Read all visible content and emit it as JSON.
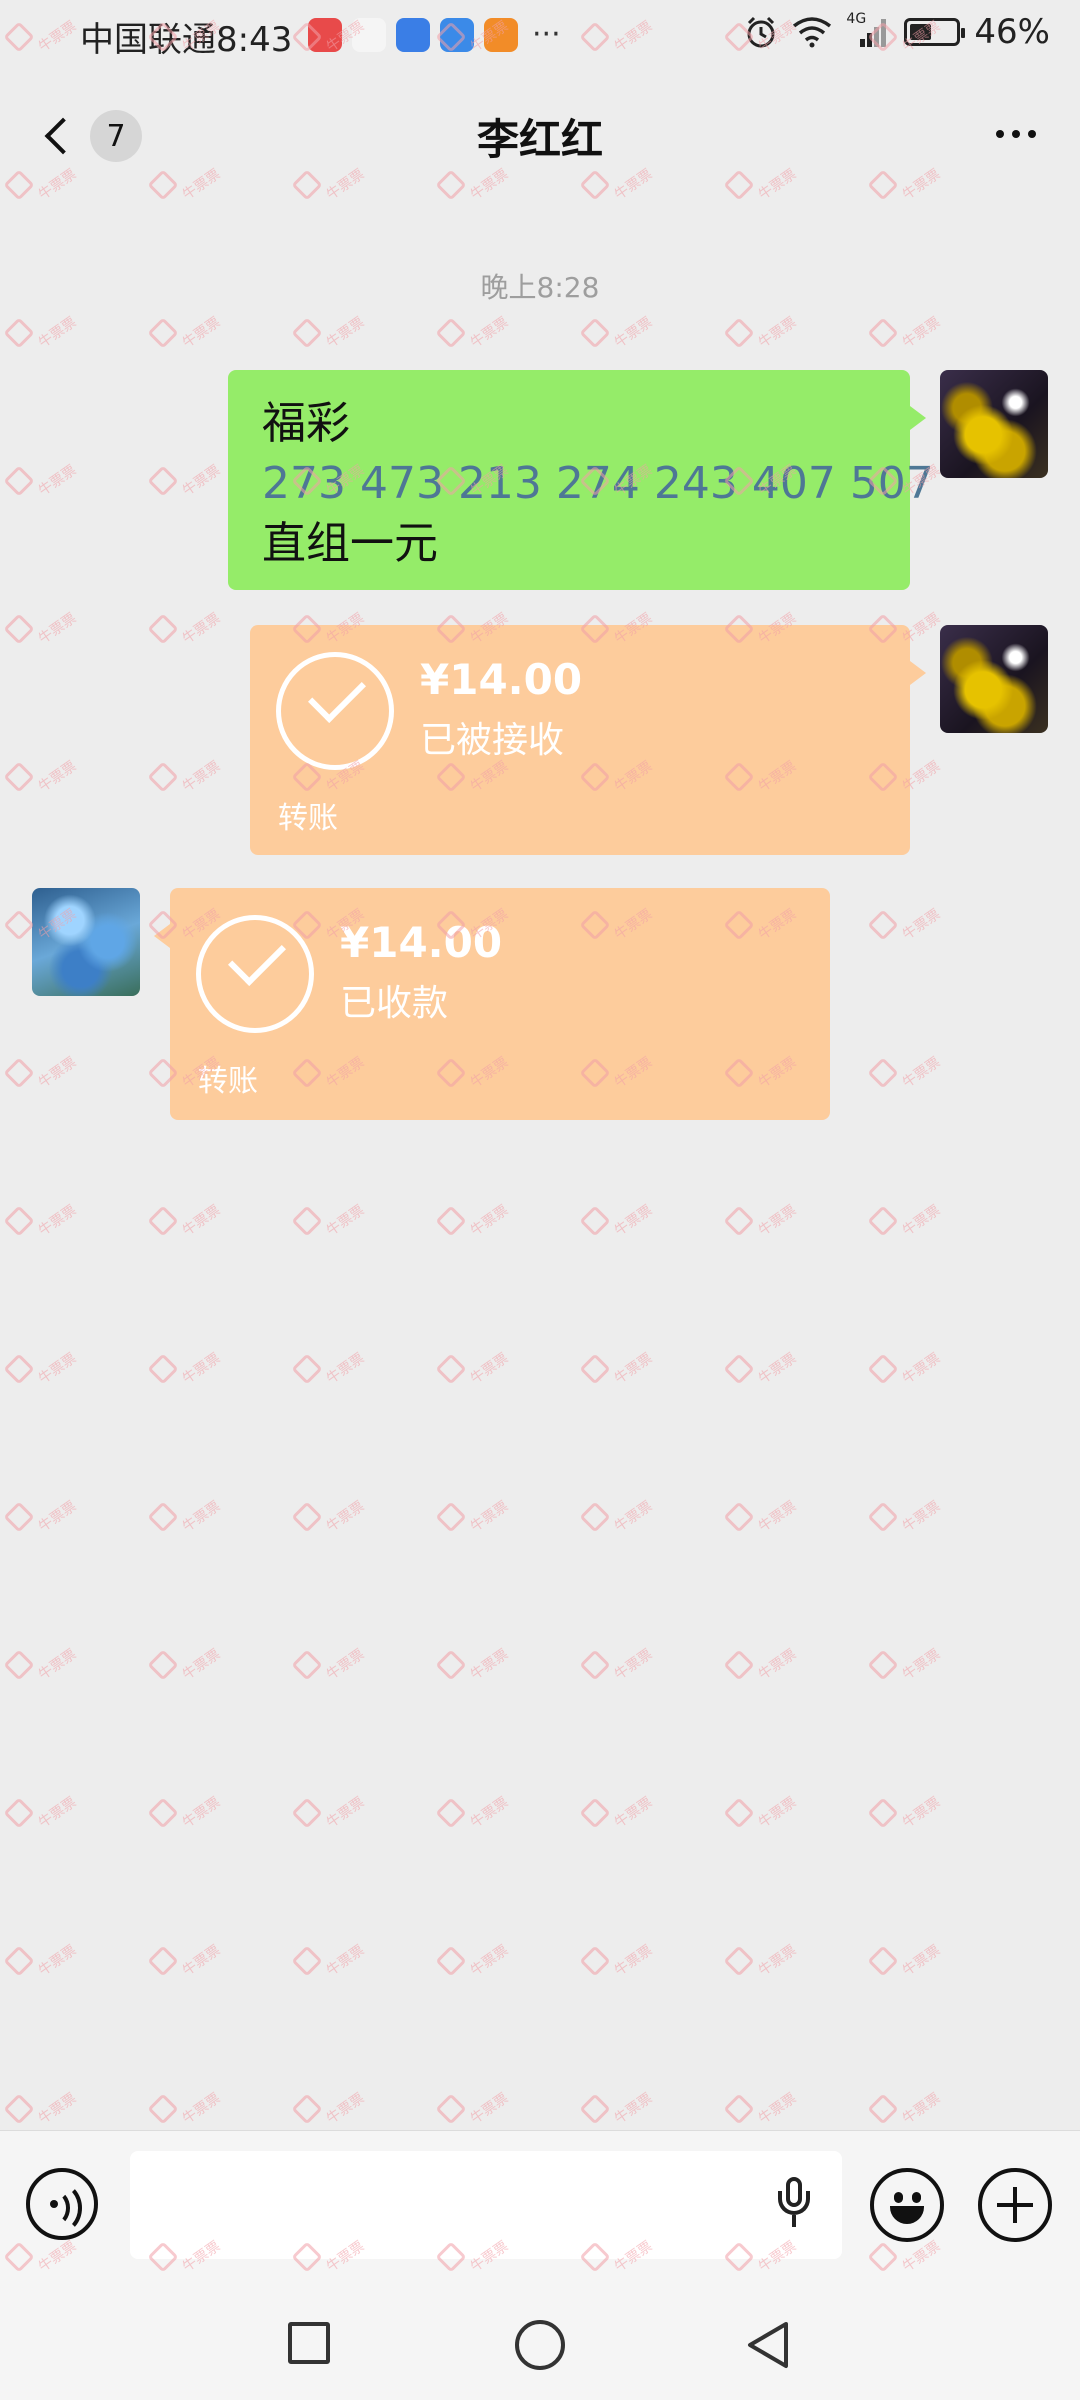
{
  "status_bar": {
    "carrier": "中国联通",
    "time": "8:43",
    "network": "4G",
    "battery_percent": "46%",
    "battery_level": 0.46,
    "app_icons": [
      {
        "name": "huawei-app-icon",
        "color": "#e84a4a"
      },
      {
        "name": "game-app-icon",
        "color": "#f5f5f5"
      },
      {
        "name": "browser-app-icon",
        "color": "#3a7ee6"
      },
      {
        "name": "weather-app-icon",
        "color": "#3b8ae8"
      },
      {
        "name": "video-app-icon",
        "color": "#f28c28"
      }
    ],
    "more": "···"
  },
  "header": {
    "unread_count": "7",
    "title": "李红红",
    "more_icon": "more-dots-icon",
    "back_icon": "chevron-left-icon"
  },
  "conversation": {
    "timestamp": "晚上8:28",
    "messages": {
      "text_message": {
        "line1": "福彩",
        "line2": "273 473 213 274 243 407 507",
        "line3": "直组一元"
      },
      "transfer_sent": {
        "amount": "¥14.00",
        "status": "已被接收",
        "footer": "转账"
      },
      "transfer_received": {
        "amount": "¥14.00",
        "status": "已收款",
        "footer": "转账"
      }
    }
  },
  "input_bar": {
    "placeholder": "",
    "voice_icon": "voice-mode-icon",
    "mic_icon": "microphone-icon",
    "emoji_icon": "emoji-icon",
    "plus_icon": "plus-icon"
  },
  "colors": {
    "background": "#ededed",
    "bubble_green": "#95ec69",
    "transfer_orange": "#fdcc9c",
    "number_text": "#4e7795",
    "timestamp_gray": "#9e9e9e"
  },
  "watermark": {
    "text": "牛票票"
  }
}
